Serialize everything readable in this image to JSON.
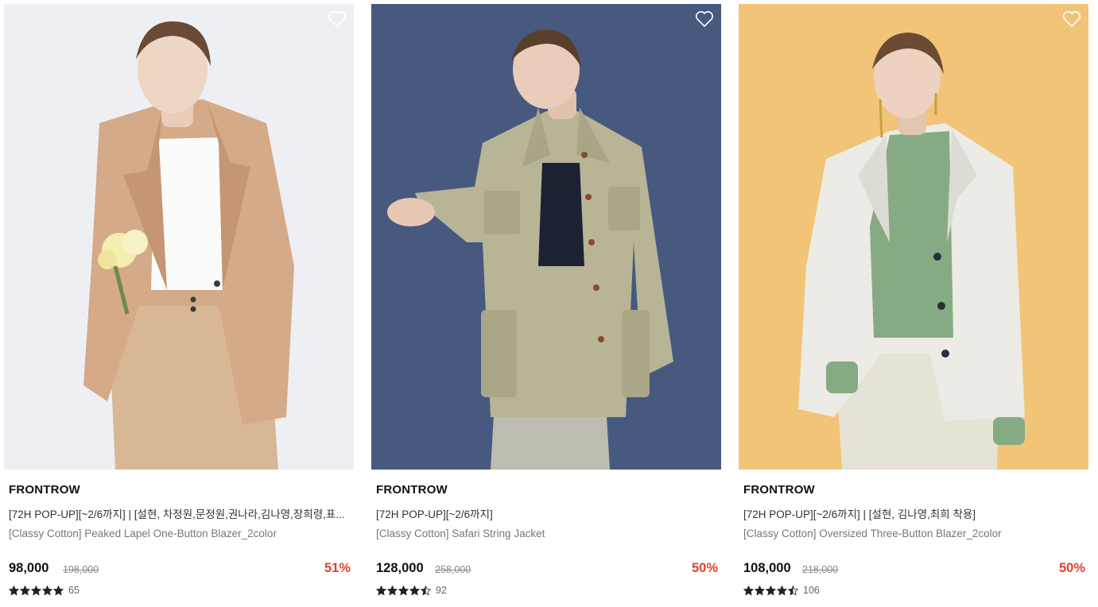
{
  "products": [
    {
      "brand": "FRONTROW",
      "promo": "[72H POP-UP][~2/6까지] | [설현, 차정원,문정원,권나라,김나영,장희령,표...",
      "name": "[Classy Cotton] Peaked Lapel One-Button Blazer_2color",
      "price": "98,000",
      "original_price": "198,000",
      "discount": "51%",
      "rating_stars": 5,
      "review_count": "65",
      "wishlist_icon": "heart-outline-icon",
      "colors": {
        "background": "#eeeff2",
        "garment": "#d4aa88",
        "inner": "#fbfbfb"
      }
    },
    {
      "brand": "FRONTROW",
      "promo": "[72H POP-UP][~2/6까지]",
      "name": "[Classy Cotton] Safari String Jacket",
      "price": "128,000",
      "original_price": "258,000",
      "discount": "50%",
      "rating_stars": 4.5,
      "review_count": "92",
      "wishlist_icon": "heart-outline-icon",
      "colors": {
        "background": "#4d5f86",
        "garment": "#b7b596",
        "inner": "#1c2233"
      }
    },
    {
      "brand": "FRONTROW",
      "promo": "[72H POP-UP][~2/6까지] | [설현, 김나영,최희 착용]",
      "name": "[Classy Cotton] Oversized Three-Button Blazer_2color",
      "price": "108,000",
      "original_price": "218,000",
      "discount": "50%",
      "rating_stars": 4.5,
      "review_count": "106",
      "wishlist_icon": "heart-outline-icon",
      "colors": {
        "background": "#f0bf6e",
        "garment": "#ecebe5",
        "inner": "#86ab84"
      }
    }
  ],
  "colors": {
    "discount": "#e4412b",
    "price": "#111111",
    "muted": "#888888",
    "star": "#222222"
  }
}
